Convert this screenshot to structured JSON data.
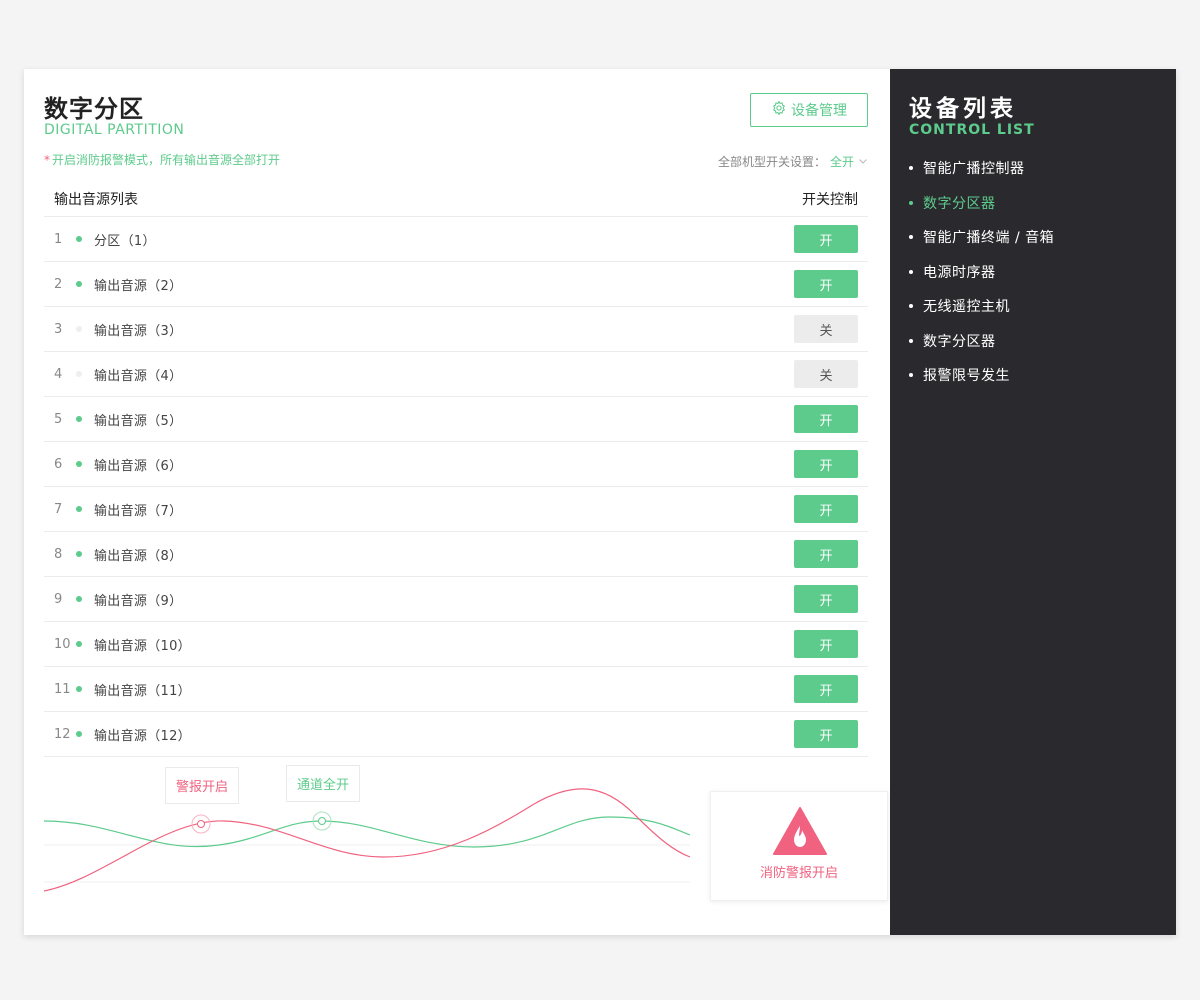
{
  "header": {
    "title": "数字分区",
    "subtitle": "DIGITAL PARTITION",
    "manage_button": "设备管理",
    "notice_star": "*",
    "notice": "开启消防报警模式，所有输出音源全部打开",
    "all_switch_label": "全部机型开关设置：",
    "all_switch_value": "全开"
  },
  "table": {
    "col_source": "输出音源列表",
    "col_control": "开关控制",
    "rows": [
      {
        "index": "1",
        "name": "分区（1）",
        "state": "on",
        "label": "开"
      },
      {
        "index": "2",
        "name": "输出音源（2）",
        "state": "on",
        "label": "开"
      },
      {
        "index": "3",
        "name": "输出音源（3）",
        "state": "off",
        "label": "关"
      },
      {
        "index": "4",
        "name": "输出音源（4）",
        "state": "off",
        "label": "关"
      },
      {
        "index": "5",
        "name": "输出音源（5）",
        "state": "on",
        "label": "开"
      },
      {
        "index": "6",
        "name": "输出音源（6）",
        "state": "on",
        "label": "开"
      },
      {
        "index": "7",
        "name": "输出音源（7）",
        "state": "on",
        "label": "开"
      },
      {
        "index": "8",
        "name": "输出音源（8）",
        "state": "on",
        "label": "开"
      },
      {
        "index": "9",
        "name": "输出音源（9）",
        "state": "on",
        "label": "开"
      },
      {
        "index": "10",
        "name": "输出音源（10）",
        "state": "on",
        "label": "开"
      },
      {
        "index": "11",
        "name": "输出音源（11）",
        "state": "on",
        "label": "开"
      },
      {
        "index": "12",
        "name": "输出音源（12）",
        "state": "on",
        "label": "开"
      }
    ]
  },
  "wave": {
    "tag_alarm": "警报开启",
    "tag_channels": "通道全开",
    "alarm_card_label": "消防警报开启"
  },
  "sidebar": {
    "title": "设备列表",
    "subtitle": "CONTROL LIST",
    "items": [
      {
        "label": "智能广播控制器",
        "active": false
      },
      {
        "label": "数字分区器",
        "active": true
      },
      {
        "label": "智能广播终端 / 音箱",
        "active": false
      },
      {
        "label": "电源时序器",
        "active": false
      },
      {
        "label": "无线遥控主机",
        "active": false
      },
      {
        "label": "数字分区器",
        "active": false
      },
      {
        "label": "报警限号发生",
        "active": false
      }
    ]
  },
  "colors": {
    "accent": "#5dcb8c",
    "alarm": "#f0627f",
    "sidebar_bg": "#2a2a2e"
  },
  "icons": {
    "manage": "gear-icon",
    "dropdown": "chevron-down-icon",
    "alarm": "fire-warning-icon"
  }
}
